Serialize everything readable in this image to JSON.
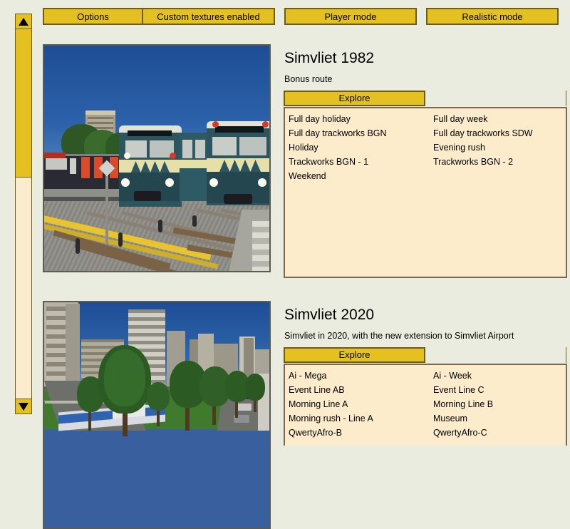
{
  "toolbar": {
    "buttons": [
      {
        "name": "options-button",
        "label": "Options"
      },
      {
        "name": "custom-textures-button",
        "label": "Custom textures enabled"
      },
      {
        "name": "player-mode-button",
        "label": "Player mode"
      },
      {
        "name": "realistic-mode-button",
        "label": "Realistic mode"
      }
    ]
  },
  "scrollbar": {
    "up_arrow_icon": "triangle-up-icon",
    "down_arrow_icon": "triangle-down-icon"
  },
  "routes": [
    {
      "title": "Simvliet 1982",
      "description": "Bonus route",
      "explore_label": "Explore",
      "scenarios": [
        "Full day holiday",
        "Full day week",
        "Full day trackworks BGN",
        "Full day trackworks SDW",
        "Holiday",
        "Evening rush",
        "Trackworks BGN - 1",
        "Trackworks BGN - 2",
        "Weekend"
      ]
    },
    {
      "title": "Simvliet 2020",
      "description": "Simvliet in 2020, with the new extension to Simvliet Airport",
      "explore_label": "Explore",
      "scenarios": [
        "Ai - Mega",
        "Ai - Week",
        "Event Line AB",
        "Event Line C",
        "Morning Line A",
        "Morning Line B",
        "Morning rush - Line A",
        "Museum",
        "QwertyAfro-B",
        "QwertyAfro-C"
      ]
    }
  ],
  "colors": {
    "background": "#ebece0",
    "button_fill": "#e5c021",
    "button_border": "#6e5d12",
    "panel_fill": "#fdeccb",
    "panel_border": "#7a6a52",
    "text": "#000000"
  }
}
